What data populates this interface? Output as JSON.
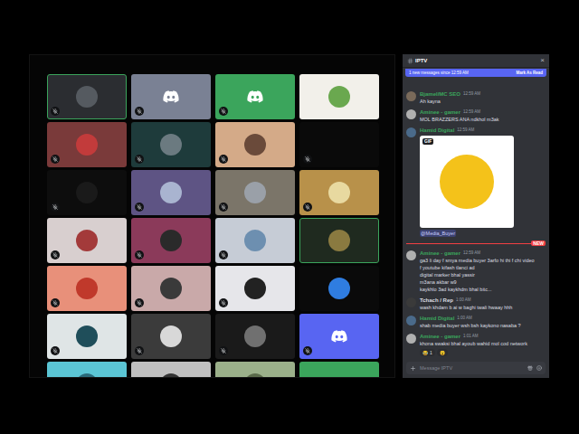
{
  "voice_grid": {
    "tiles": [
      {
        "kind": "avatar",
        "color": "#2b2d31",
        "avatar_color": "#555a60",
        "muted": true,
        "speaking": true
      },
      {
        "kind": "discord-logo",
        "color": "#7a8194",
        "avatar_color": "#ffffff",
        "muted": true,
        "speaking": false
      },
      {
        "kind": "discord-logo",
        "color": "#3ba55c",
        "avatar_color": "#ffffff",
        "muted": true,
        "speaking": false
      },
      {
        "kind": "avatar",
        "color": "#f2f0ea",
        "avatar_color": "#6aa84f",
        "muted": false,
        "speaking": false
      },
      {
        "kind": "avatar",
        "color": "#7a3a3a",
        "avatar_color": "#c23b3b",
        "muted": true,
        "speaking": false
      },
      {
        "kind": "avatar",
        "color": "#1e3b3b",
        "avatar_color": "#6b7a80",
        "muted": true,
        "speaking": false
      },
      {
        "kind": "avatar",
        "color": "#d4aa88",
        "avatar_color": "#6a4a3a",
        "muted": true,
        "speaking": false
      },
      {
        "kind": "none",
        "color": "#0a0a0a",
        "avatar_color": "#0a0a0a",
        "muted": true,
        "speaking": false
      },
      {
        "kind": "avatar",
        "color": "#0d0d0d",
        "avatar_color": "#1a1a1a",
        "muted": true,
        "speaking": false
      },
      {
        "kind": "avatar",
        "color": "#5e5484",
        "avatar_color": "#a9b4d0",
        "muted": true,
        "speaking": false
      },
      {
        "kind": "avatar",
        "color": "#7b7569",
        "avatar_color": "#9aa0a8",
        "muted": true,
        "speaking": false
      },
      {
        "kind": "avatar",
        "color": "#b8914a",
        "avatar_color": "#e8d9a0",
        "muted": true,
        "speaking": false
      },
      {
        "kind": "avatar",
        "color": "#d8cfcf",
        "avatar_color": "#a33a3a",
        "muted": true,
        "speaking": false
      },
      {
        "kind": "avatar",
        "color": "#8b3a5a",
        "avatar_color": "#2a2a2a",
        "muted": true,
        "speaking": false
      },
      {
        "kind": "avatar",
        "color": "#c6ccd6",
        "avatar_color": "#6d8fb0",
        "muted": true,
        "speaking": false
      },
      {
        "kind": "avatar",
        "color": "#1f2a1f",
        "avatar_color": "#8a7a40",
        "muted": false,
        "speaking": true
      },
      {
        "kind": "avatar",
        "color": "#e8907a",
        "avatar_color": "#c0392b",
        "muted": true,
        "speaking": false
      },
      {
        "kind": "avatar",
        "color": "#c9a9a9",
        "avatar_color": "#3a3a3a",
        "muted": true,
        "speaking": false
      },
      {
        "kind": "avatar",
        "color": "#e6e6ea",
        "avatar_color": "#222222",
        "muted": true,
        "speaking": false
      },
      {
        "kind": "avatar",
        "color": "#0a0a0a",
        "avatar_color": "#2f7de1",
        "muted": false,
        "speaking": false
      },
      {
        "kind": "avatar",
        "color": "#dfe5e6",
        "avatar_color": "#1f4e5a",
        "muted": true,
        "speaking": false
      },
      {
        "kind": "avatar",
        "color": "#3b3b3b",
        "avatar_color": "#d8d8d8",
        "muted": true,
        "speaking": false
      },
      {
        "kind": "avatar",
        "color": "#1a1a1a",
        "avatar_color": "#707070",
        "muted": true,
        "speaking": false
      },
      {
        "kind": "discord-logo",
        "color": "#5865f2",
        "avatar_color": "#ffffff",
        "muted": true,
        "speaking": false
      },
      {
        "kind": "avatar",
        "color": "#5bc5d4",
        "avatar_color": "#2a6a7a",
        "muted": false,
        "speaking": false
      },
      {
        "kind": "avatar",
        "color": "#c0c0c0",
        "avatar_color": "#333333",
        "muted": false,
        "speaking": false
      },
      {
        "kind": "avatar",
        "color": "#9bb08a",
        "avatar_color": "#5a6a4a",
        "muted": false,
        "speaking": false
      },
      {
        "kind": "discord-logo",
        "color": "#3ba55c",
        "avatar_color": "#ffffff",
        "muted": false,
        "speaking": false
      }
    ]
  },
  "chat": {
    "title": "IPTV",
    "close": "×",
    "banner": {
      "text": "1 new messages since 12:59 AM",
      "action": "Mark As Read"
    },
    "messages": [
      {
        "author": "Bjamel/MC SEO",
        "time": "12:59 AM",
        "name_color": "#3ba55c",
        "avatar_color": "#7a6a5a",
        "lines": [
          "Ah kayna"
        ],
        "gif": null,
        "mention": null,
        "reactions": []
      },
      {
        "author": "Aminee - gamer",
        "time": "12:59 AM",
        "name_color": "#3ba55c",
        "avatar_color": "#b0b0b0",
        "lines": [
          "MOL BRAZZERS ANA ndkhol m3ak"
        ],
        "gif": null,
        "mention": null,
        "reactions": []
      },
      {
        "author": "Hamid Digital",
        "time": "12:59 AM",
        "name_color": "#3ba55c",
        "avatar_color": "#4a6a8a",
        "lines": [],
        "gif": {
          "badge": "GIF"
        },
        "mention": "@Media_Buyer",
        "reactions": []
      },
      {
        "author": "Aminee - gamer",
        "time": "12:59 AM",
        "name_color": "#3ba55c",
        "avatar_color": "#b0b0b0",
        "lines": [
          "ga3 li day f smya media buyer 3arfo hi thi f chi video",
          "f youtube kifash tlanci ad",
          "digital marker bhal yassir",
          "m3ana akbar w9",
          "kaykhlo 3ad kaykhdm bhal bitc..."
        ],
        "gif": null,
        "mention": null,
        "reactions": [],
        "new_divider": "NEW"
      },
      {
        "author": "Tchach / Rep",
        "time": "1:00 AM",
        "name_color": "#dbdee1",
        "avatar_color": "#3a3a3a",
        "lines": [
          "wash khdam b ai w baghi twali hwaay hhh"
        ],
        "gif": null,
        "mention": null,
        "reactions": []
      },
      {
        "author": "Hamid Digital",
        "time": "1:00 AM",
        "name_color": "#3ba55c",
        "avatar_color": "#4a6a8a",
        "lines": [
          "shab media buyer wsh bsh kaykono nasaba ?"
        ],
        "gif": null,
        "mention": null,
        "reactions": []
      },
      {
        "author": "Aminee - gamer",
        "time": "1:01 AM",
        "name_color": "#3ba55c",
        "avatar_color": "#b0b0b0",
        "lines": [
          "khona swaksi bhal ayoub wahid mol cod network"
        ],
        "gif": null,
        "mention": null,
        "reactions": [
          {
            "emoji": "😂",
            "count": "1"
          },
          {
            "emoji": "😮",
            "count": ""
          }
        ]
      }
    ],
    "input": {
      "placeholder": "Message IPTV"
    }
  }
}
